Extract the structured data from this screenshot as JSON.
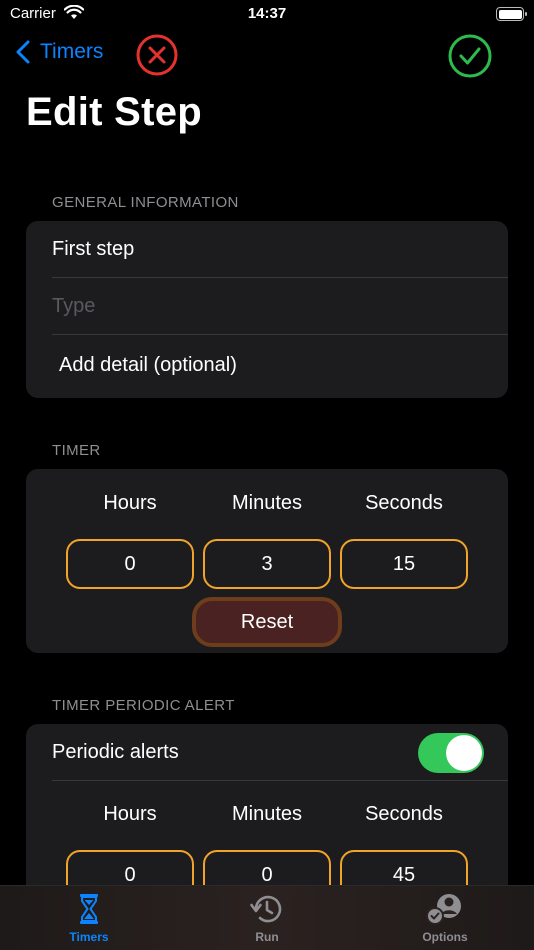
{
  "status_bar": {
    "carrier": "Carrier",
    "time": "14:37"
  },
  "nav": {
    "back_label": "Timers"
  },
  "page": {
    "title": "Edit Step"
  },
  "general": {
    "header": "GENERAL INFORMATION",
    "name_value": "First step",
    "type_placeholder": "Type",
    "detail_label": "Add detail (optional)"
  },
  "timer": {
    "header": "TIMER",
    "labels": [
      "Hours",
      "Minutes",
      "Seconds"
    ],
    "values": [
      "0",
      "3",
      "15"
    ],
    "reset_label": "Reset"
  },
  "periodic": {
    "header": "TIMER PERIODIC ALERT",
    "toggle_label": "Periodic alerts",
    "toggle_on": true,
    "labels": [
      "Hours",
      "Minutes",
      "Seconds"
    ],
    "values": [
      "0",
      "0",
      "45"
    ]
  },
  "tabs": [
    {
      "label": "Timers",
      "icon": "hourglass-icon",
      "active": true
    },
    {
      "label": "Run",
      "icon": "history-icon",
      "active": false
    },
    {
      "label": "Options",
      "icon": "user-settings-icon",
      "active": false
    }
  ],
  "colors": {
    "accent_blue": "#0a84ff",
    "field_orange": "#f2a32a",
    "toggle_green": "#34c759",
    "cancel_red": "#e5322d",
    "confirm_green": "#2dbb4e"
  }
}
